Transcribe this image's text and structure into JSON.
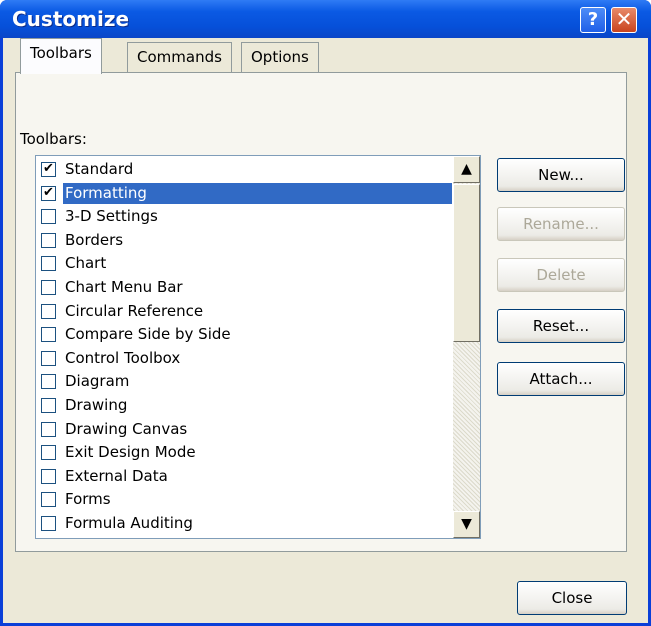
{
  "window": {
    "title": "Customize",
    "help_glyph": "?",
    "close_glyph": "✕"
  },
  "tabs": [
    "Toolbars",
    "Commands",
    "Options"
  ],
  "panel": {
    "label": "Toolbars:"
  },
  "toolbars": [
    {
      "label": "Standard",
      "checked": true,
      "selected": false
    },
    {
      "label": "Formatting",
      "checked": true,
      "selected": true
    },
    {
      "label": "3-D Settings",
      "checked": false,
      "selected": false
    },
    {
      "label": "Borders",
      "checked": false,
      "selected": false
    },
    {
      "label": "Chart",
      "checked": false,
      "selected": false
    },
    {
      "label": "Chart Menu Bar",
      "checked": false,
      "selected": false
    },
    {
      "label": "Circular Reference",
      "checked": false,
      "selected": false
    },
    {
      "label": "Compare Side by Side",
      "checked": false,
      "selected": false
    },
    {
      "label": "Control Toolbox",
      "checked": false,
      "selected": false
    },
    {
      "label": "Diagram",
      "checked": false,
      "selected": false
    },
    {
      "label": "Drawing",
      "checked": false,
      "selected": false
    },
    {
      "label": "Drawing Canvas",
      "checked": false,
      "selected": false
    },
    {
      "label": "Exit Design Mode",
      "checked": false,
      "selected": false
    },
    {
      "label": "External Data",
      "checked": false,
      "selected": false
    },
    {
      "label": "Forms",
      "checked": false,
      "selected": false
    },
    {
      "label": "Formula Auditing",
      "checked": false,
      "selected": false
    }
  ],
  "buttons": {
    "new": "New...",
    "rename": "Rename...",
    "delete": "Delete",
    "reset": "Reset...",
    "attach": "Attach...",
    "close": "Close"
  },
  "icons": {
    "checkmark": "✔",
    "scroll_up": "▲",
    "scroll_down": "▼"
  }
}
